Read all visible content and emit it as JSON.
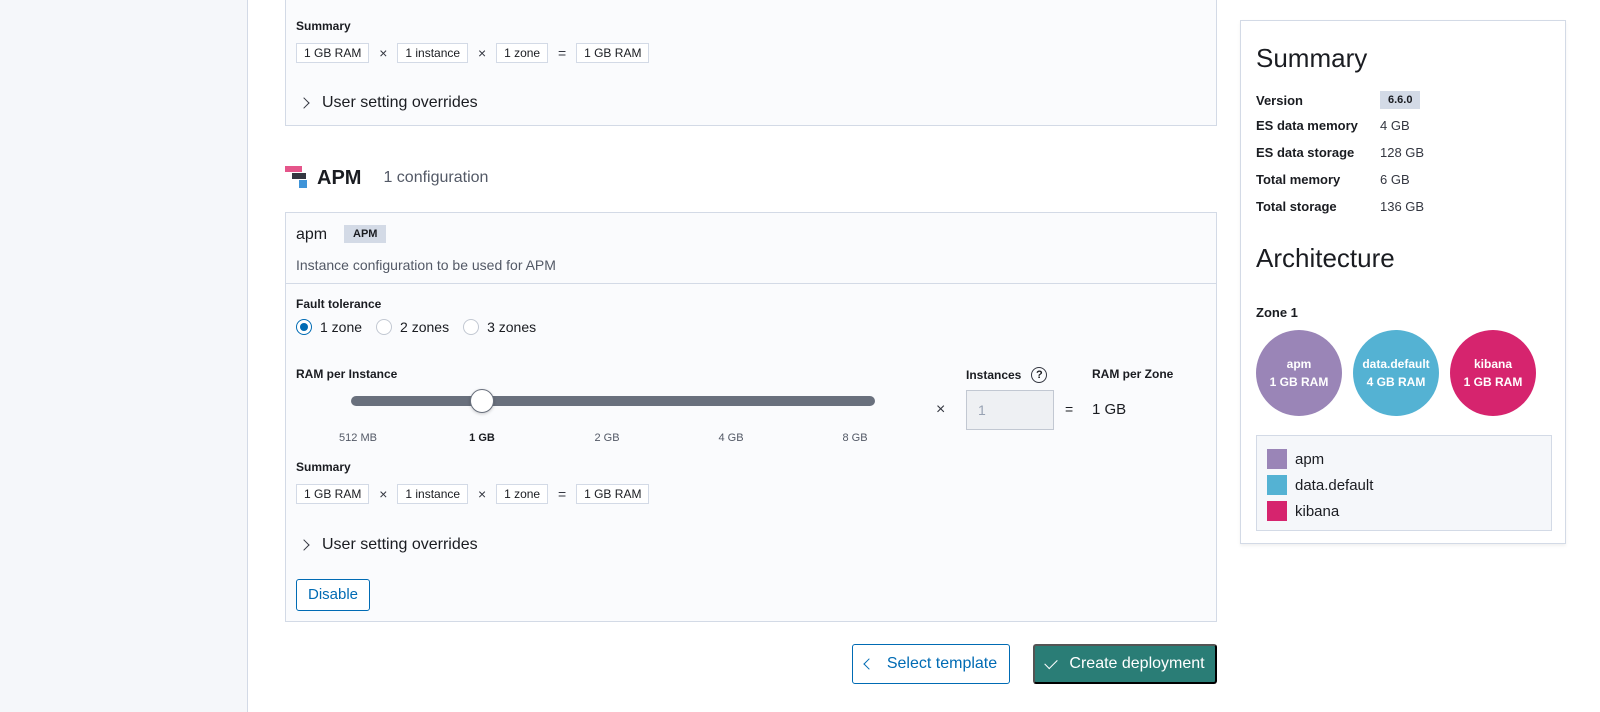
{
  "top_section": {
    "summary_label": "Summary",
    "calc": {
      "ram": "1 GB RAM",
      "times1": "×",
      "instances": "1 instance",
      "times2": "×",
      "zones": "1 zone",
      "equals": "=",
      "total": "1 GB RAM"
    },
    "overrides_label": "User setting overrides"
  },
  "apm_section": {
    "title": "APM",
    "subtitle": "1 configuration",
    "card": {
      "name": "apm",
      "badge": "APM",
      "description": "Instance configuration to be used for APM",
      "fault_tolerance_label": "Fault tolerance",
      "zones_options": [
        {
          "label": "1 zone",
          "selected": true
        },
        {
          "label": "2 zones",
          "selected": false
        },
        {
          "label": "3 zones",
          "selected": false
        }
      ],
      "ram_per_instance_label": "RAM per Instance",
      "slider": {
        "ticks": [
          "512 MB",
          "1 GB",
          "2 GB",
          "4 GB",
          "8 GB"
        ],
        "selected": "1 GB",
        "selected_index": 1
      },
      "times": "×",
      "instances_label": "Instances",
      "help_icon_glyph": "?",
      "instances_value": "1",
      "equals": "=",
      "ram_per_zone_label": "RAM per Zone",
      "ram_per_zone_value": "1 GB",
      "summary_label": "Summary",
      "calc": {
        "ram": "1 GB RAM",
        "times1": "×",
        "instances": "1 instance",
        "times2": "×",
        "zones": "1 zone",
        "equals": "=",
        "total": "1 GB RAM"
      },
      "overrides_label": "User setting overrides",
      "disable_label": "Disable"
    }
  },
  "footer": {
    "select_template_label": "Select template",
    "create_deployment_label": "Create deployment"
  },
  "summary": {
    "title": "Summary",
    "rows": [
      {
        "key": "Version",
        "value": "6.6.0"
      },
      {
        "key": "ES data memory",
        "value": "4 GB"
      },
      {
        "key": "ES data storage",
        "value": "128 GB"
      },
      {
        "key": "Total memory",
        "value": "6 GB"
      },
      {
        "key": "Total storage",
        "value": "136 GB"
      }
    ],
    "architecture_title": "Architecture",
    "zone_label": "Zone 1",
    "nodes": [
      {
        "name": "apm",
        "ram": "1 GB RAM",
        "color": "#9a85b7"
      },
      {
        "name": "data.default",
        "ram": "4 GB RAM",
        "color": "#54b2d3"
      },
      {
        "name": "kibana",
        "ram": "1 GB RAM",
        "color": "#d6246e"
      }
    ],
    "legend": [
      {
        "label": "apm",
        "color": "#9a85b7"
      },
      {
        "label": "data.default",
        "color": "#54b2d3"
      },
      {
        "label": "kibana",
        "color": "#d6246e"
      }
    ]
  },
  "colors": {
    "primary": "#006bb4",
    "success": "#2a7d76"
  }
}
